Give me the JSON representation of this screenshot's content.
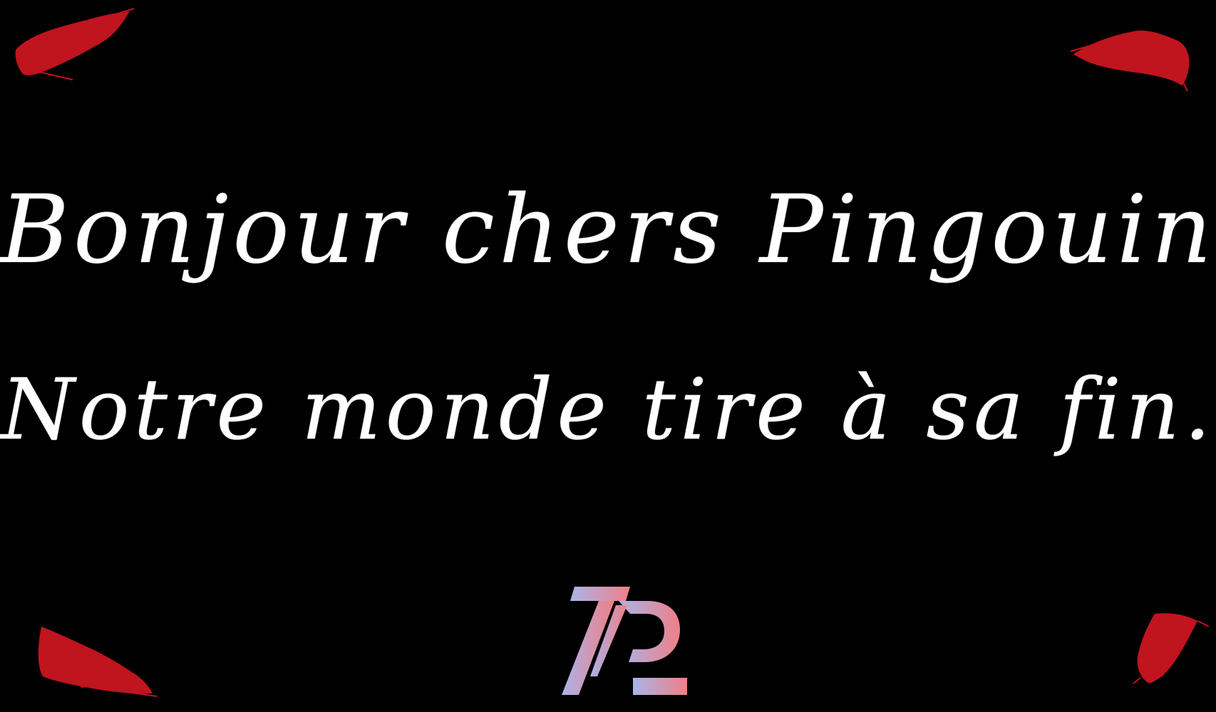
{
  "message": {
    "line1": "Bonjour chers Pingouins,",
    "line2": "Notre monde tire à sa fin."
  },
  "logo": {
    "text": "TP",
    "gradient_start": "#a9b4ea",
    "gradient_end": "#f07f86"
  },
  "colors": {
    "background": "#000000",
    "text": "#ffffff",
    "splash": "#c0141f"
  }
}
